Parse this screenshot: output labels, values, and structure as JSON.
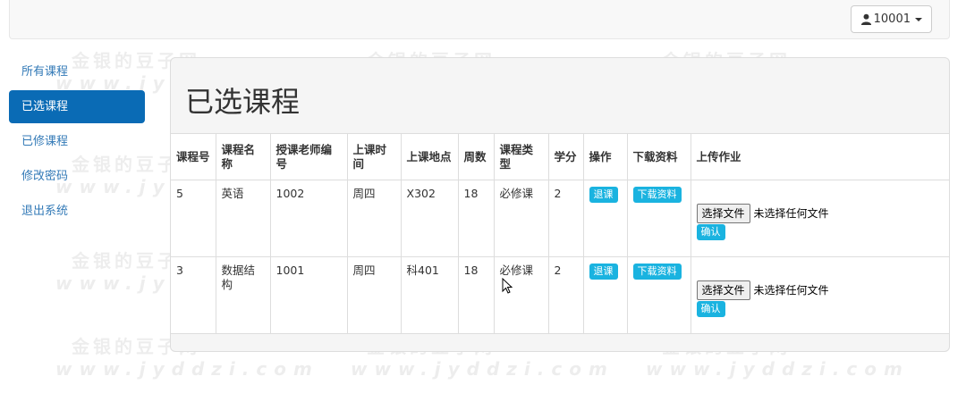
{
  "navbar": {
    "user_label": "10001",
    "user_icon": "user-icon"
  },
  "sidebar": {
    "items": [
      {
        "label": "所有课程"
      },
      {
        "label": "已选课程"
      },
      {
        "label": "已修课程"
      },
      {
        "label": "修改密码"
      },
      {
        "label": "退出系统"
      }
    ],
    "active_index": 1
  },
  "panel": {
    "title": "已选课程"
  },
  "table": {
    "headers": [
      "课程号",
      "课程名称",
      "授课老师编号",
      "上课时间",
      "上课地点",
      "周数",
      "课程类型",
      "学分",
      "操作",
      "下载资料",
      "上传作业"
    ],
    "rows": [
      {
        "id": "5",
        "name": "英语",
        "teacher": "1002",
        "time": "周四",
        "place": "X302",
        "weeks": "18",
        "type": "必修课",
        "credit": "2"
      },
      {
        "id": "3",
        "name": "数据结构",
        "teacher": "1001",
        "time": "周四",
        "place": "科401",
        "weeks": "18",
        "type": "必修课",
        "credit": "2"
      }
    ],
    "drop_label": "退课",
    "download_label": "下载资料",
    "file_button_label": "选择文件",
    "file_status": "未选择任何文件",
    "confirm_label": "确认"
  },
  "watermark": {
    "line1": "金银的豆子网",
    "line2": "www.jyddzi.com"
  },
  "colors": {
    "accent": "#0a6bb5",
    "button": "#1ab3e0",
    "link": "#337ab7"
  }
}
